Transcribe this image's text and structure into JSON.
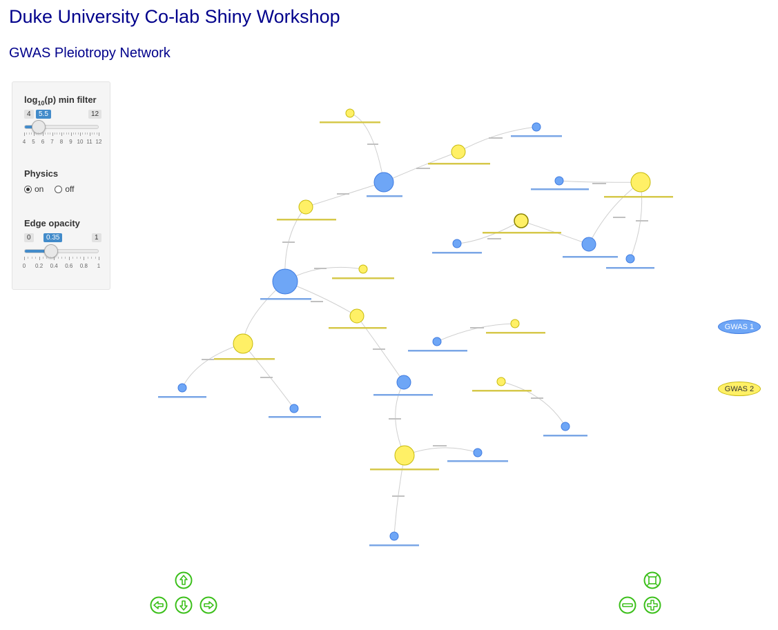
{
  "app": {
    "title": "Duke University Co-lab Shiny Workshop",
    "subtitle": "GWAS Pleiotropy Network"
  },
  "controls": {
    "pfilter": {
      "label_main": "log",
      "label_sub": "10",
      "label_rest": "(p) min filter",
      "min": "4",
      "max": "12",
      "value": "5.5",
      "value_num": 5.5,
      "min_num": 4,
      "max_num": 12,
      "ticks": [
        "4",
        "5",
        "6",
        "7",
        "8",
        "9",
        "10",
        "11",
        "12"
      ]
    },
    "physics": {
      "label": "Physics",
      "options": [
        "on",
        "off"
      ],
      "selected": "on"
    },
    "opacity": {
      "label": "Edge opacity",
      "min": "0",
      "max": "1",
      "value": "0.35",
      "value_num": 0.35,
      "min_num": 0,
      "max_num": 1,
      "ticks": [
        "0",
        "0.2",
        "0.4",
        "0.6",
        "0.8",
        "1"
      ]
    }
  },
  "legend": {
    "group1": "GWAS 1",
    "group2": "GWAS 2"
  },
  "colors": {
    "gwas1": "#6ea6f6",
    "gwas1_border": "#3f7be0",
    "gwas2": "#fff066",
    "gwas2_border": "#c6b90a",
    "title": "#00008b",
    "accent": "#428bca",
    "nav": "#3bbf1a"
  },
  "icons": {
    "nav_up": "arrow-up-icon",
    "nav_left": "arrow-left-icon",
    "nav_down": "arrow-down-icon",
    "nav_right": "arrow-right-icon",
    "zoom_fit": "zoom-extend-icon",
    "zoom_out": "zoom-out-icon",
    "zoom_in": "zoom-in-icon"
  }
}
